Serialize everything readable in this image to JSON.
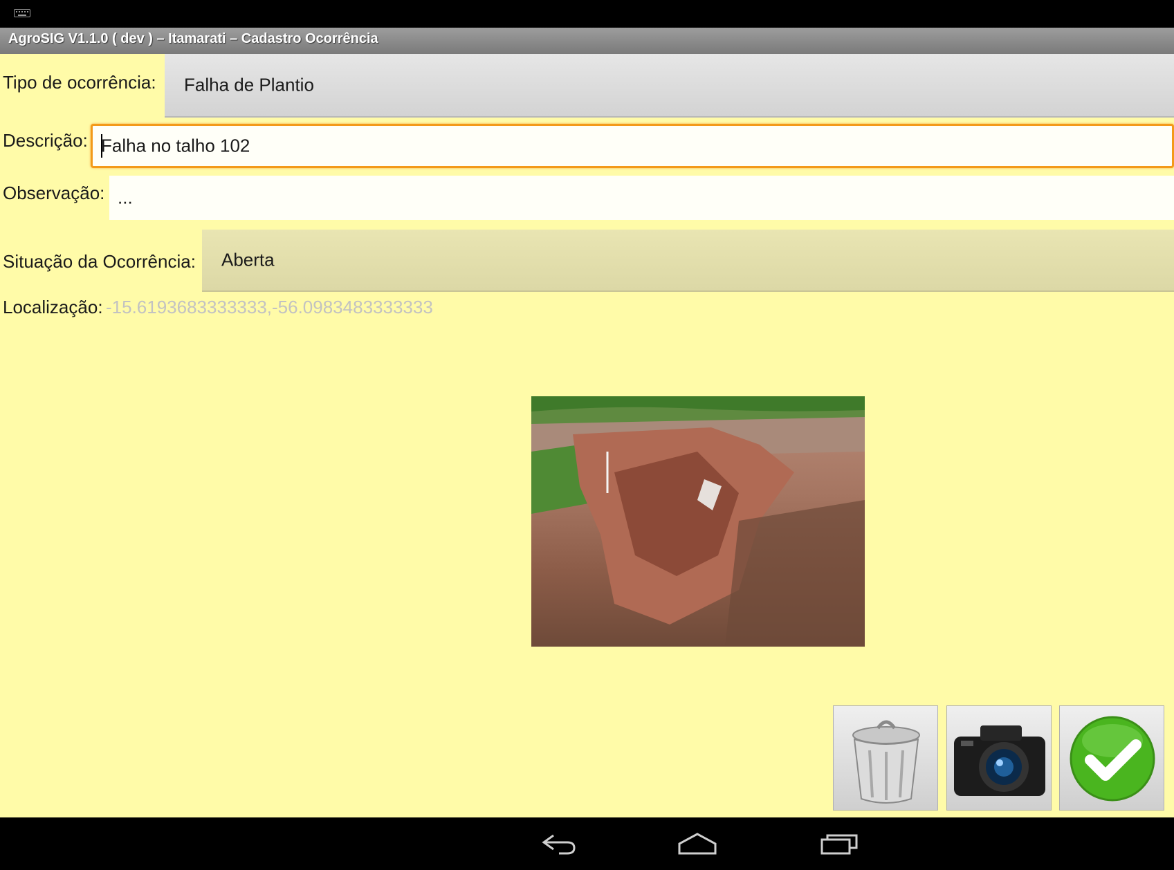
{
  "app": {
    "title": "AgroSIG V1.1.0 ( dev )  – Itamarati – Cadastro Ocorrência"
  },
  "form": {
    "tipo_label": "Tipo de ocorrência:",
    "tipo_value": "Falha de Plantio",
    "descricao_label": "Descrição:",
    "descricao_value": "Falha no talho 102",
    "observacao_label": "Observação:",
    "observacao_value": "...",
    "situacao_label": "Situação da Ocorrência:",
    "situacao_value": "Aberta",
    "localizacao_label": "Localização:",
    "localizacao_value": "-15.6193683333333,-56.0983483333333"
  },
  "actions": {
    "delete_icon": "trash-icon",
    "camera_icon": "camera-icon",
    "confirm_icon": "check-icon"
  },
  "colors": {
    "background": "#fffba8",
    "focus": "#f39a1a",
    "confirm": "#4ab51f"
  },
  "nav": {
    "back_icon": "back-icon",
    "home_icon": "home-icon",
    "recents_icon": "recents-icon"
  }
}
